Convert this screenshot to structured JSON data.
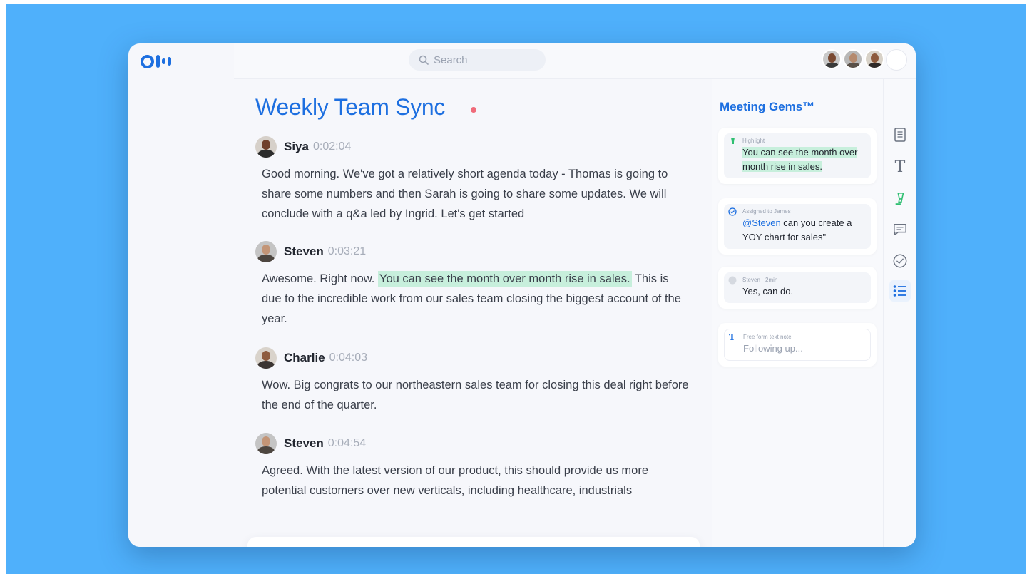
{
  "search": {
    "placeholder": "Search"
  },
  "meeting": {
    "title": "Weekly Team Sync"
  },
  "transcript": [
    {
      "speaker": "Siya",
      "time": "0:02:04",
      "text_before": "Good morning. We've got a relatively short agenda today - Thomas is going to share some numbers and then Sarah is going to share some updates. We will conclude with a q&a led by Ingrid. Let's get started",
      "highlight": "",
      "text_after": ""
    },
    {
      "speaker": "Steven",
      "time": "0:03:21",
      "text_before": "Awesome. Right now. ",
      "highlight": "You can see the month over month rise in sales.",
      "text_after": " This is due to the incredible work from our sales team closing the biggest account of the year."
    },
    {
      "speaker": "Charlie",
      "time": "0:04:03",
      "text_before": "Wow. Big congrats to our northeastern sales team for closing this deal right before the end of the quarter.",
      "highlight": "",
      "text_after": ""
    },
    {
      "speaker": "Steven",
      "time": "0:04:54",
      "text_before": "Agreed. With the latest version of our product, this should provide us more potential customers over new verticals, including healthcare, industrials",
      "highlight": "",
      "text_after": ""
    }
  ],
  "gems": {
    "title": "Meeting Gems™",
    "items": [
      {
        "label": "Highlight",
        "text": "You can see the month over month rise in sales."
      },
      {
        "label": "Assigned to James",
        "mention": "@Steven",
        "text": " can you create a YOY chart for sales\""
      },
      {
        "label": "Steven · 2min",
        "text": "Yes, can do."
      },
      {
        "label": "Free form text note",
        "text": "Following up..."
      }
    ]
  },
  "icons": {
    "logo": "otter-logo",
    "search": "search-icon",
    "rail": [
      "notes-icon",
      "text-icon",
      "highlighter-icon",
      "comment-icon",
      "check-circle-icon",
      "list-icon"
    ],
    "composer": [
      "highlighter-icon",
      "comment-icon",
      "check-circle-icon",
      "image-icon"
    ]
  },
  "colors": {
    "accent": "#1d6fe0",
    "highlight": "#c7efdc",
    "background": "#4fb0fb",
    "recording": "#f06b7a"
  }
}
